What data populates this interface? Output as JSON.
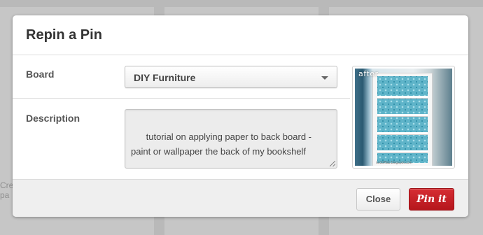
{
  "dialog": {
    "title": "Repin a Pin"
  },
  "board": {
    "label": "Board",
    "selected": "DIY Furniture"
  },
  "description": {
    "label": "Description",
    "value": "tutorial on applying paper to back board - paint or wallpaper the back of my bookshelf"
  },
  "pin_image": {
    "overlay_text": "after",
    "watermark": "nodofflab.blogspot.com"
  },
  "footer": {
    "close_label": "Close",
    "pin_label": "Pin it"
  },
  "background": {
    "edge_text": "Cre pa"
  },
  "colors": {
    "pin_button": "#cb2027",
    "backdrop": "#b9b9b9"
  }
}
